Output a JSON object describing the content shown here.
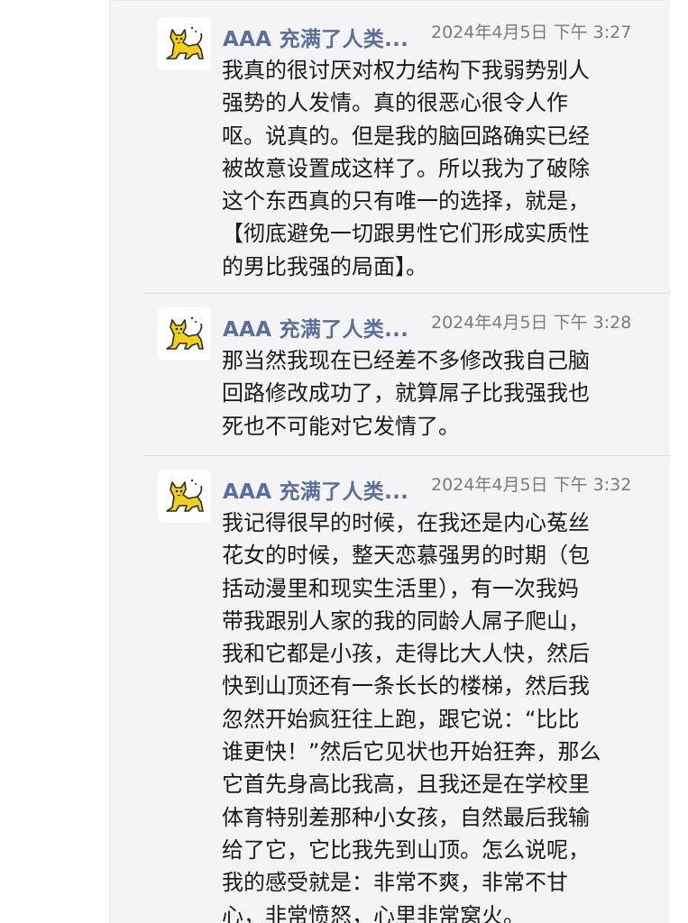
{
  "messages": [
    {
      "sender": "AAA 充满了人类...",
      "time": "2024年4月5日 下午 3:27",
      "lines": [
        "我真的很讨厌对权力结构下我弱势别人",
        "强势的人发情。真的很恶心很令人作",
        "呕。说真的。但是我的脑回路确实已经",
        "被故意设置成这样了。所以我为了破除",
        "这个东西真的只有唯一的选择，就是，",
        "【彻底避免一切跟男性它们形成实质性",
        "的男比我强的局面】。"
      ]
    },
    {
      "sender": "AAA 充满了人类...",
      "time": "2024年4月5日 下午 3:28",
      "lines": [
        "那当然我现在已经差不多修改我自己脑",
        "回路修改成功了，就算屌子比我强我也",
        "死也不可能对它发情了。"
      ]
    },
    {
      "sender": "AAA 充满了人类...",
      "time": "2024年4月5日 下午 3:32",
      "lines": [
        "我记得很早的时候，在我还是内心菟丝",
        "花女的时候，整天恋慕强男的时期（包",
        "括动漫里和现实生活里），有一次我妈",
        "带我跟别人家的我的同龄人屌子爬山，",
        "我和它都是小孩，走得比大人快，然后",
        "快到山顶还有一条长长的楼梯，然后我",
        "忽然开始疯狂往上跑，跟它说：“比比",
        "谁更快！”然后它见状也开始狂奔，那么",
        "它首先身高比我高，且我还是在学校里",
        "体育特别差那种小女孩，自然最后我输",
        "给了它，它比我先到山顶。怎么说呢，",
        "我的感受就是：非常不爽，非常不甘",
        "心，非常愤怒，心里非常窝火。"
      ]
    }
  ],
  "colors": {
    "sender": "#5b6f98",
    "time": "#7c7c80",
    "text": "#1a1a1a",
    "panel": "#f4f4f6",
    "avatar_cat": "#f2cf1f"
  },
  "avatar_icon": "yellow-cat-icon"
}
